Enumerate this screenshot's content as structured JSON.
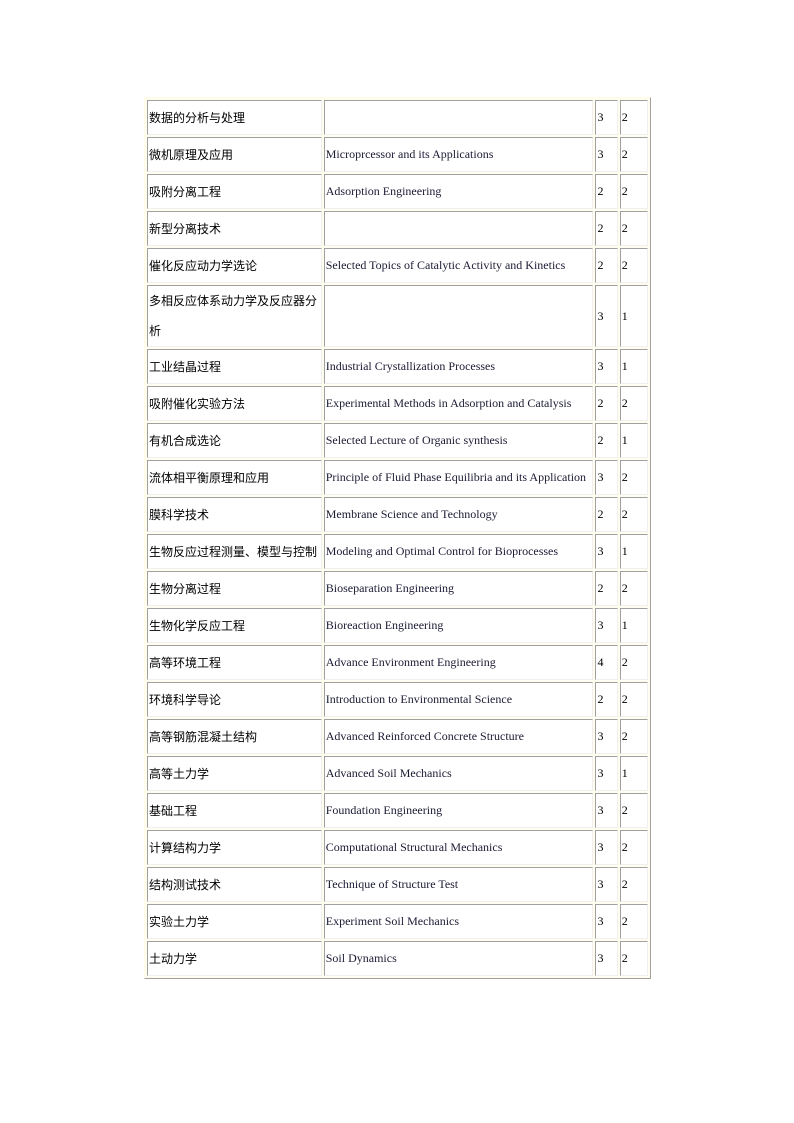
{
  "courses": [
    {
      "zh": "数据的分析与处理",
      "en": "",
      "a": "3",
      "b": "2"
    },
    {
      "zh": "微机原理及应用",
      "en": "Microprcessor and its Applications",
      "a": "3",
      "b": "2"
    },
    {
      "zh": "吸附分离工程",
      "en": "Adsorption Engineering",
      "a": "2",
      "b": "2"
    },
    {
      "zh": "新型分离技术",
      "en": "",
      "a": "2",
      "b": "2"
    },
    {
      "zh": "催化反应动力学选论",
      "en": "Selected  Topics of Catalytic  Activity and Kinetics",
      "a": "2",
      "b": "2"
    },
    {
      "zh": "多相反应体系动力学及反应器分析",
      "en": "",
      "a": "3",
      "b": "1"
    },
    {
      "zh": "工业结晶过程",
      "en": "Industrial Crystallization  Processes",
      "a": "3",
      "b": "1"
    },
    {
      "zh": "吸附催化实验方法",
      "en": "Experimental  Methods in Adsorption and Catalysis",
      "a": "2",
      "b": "2"
    },
    {
      "zh": "有机合成选论",
      "en": "Selected Lecture of Organic synthesis",
      "a": "2",
      "b": "1"
    },
    {
      "zh": "流体相平衡原理和应用",
      "en": "Principle of Fluid Phase Equilibria  and its Application",
      "a": "3",
      "b": "2"
    },
    {
      "zh": "膜科学技术",
      "en": "Membrane  Science  and  Technology",
      "a": "2",
      "b": "2"
    },
    {
      "zh": "生物反应过程测量、模型与控制",
      "en": "Modeling  and Optimal  Control  for Bioprocesses",
      "a": "3",
      "b": "1"
    },
    {
      "zh": "生物分离过程",
      "en": "Bioseparation  Engineering",
      "a": "2",
      "b": "2"
    },
    {
      "zh": "生物化学反应工程",
      "en": "Bioreaction  Engineering",
      "a": "3",
      "b": "1"
    },
    {
      "zh": "高等环境工程",
      "en": "Advance Environment Engineering",
      "a": "4",
      "b": "2"
    },
    {
      "zh": "环境科学导论",
      "en": "Introduction to Environmental  Science",
      "a": "2",
      "b": "2"
    },
    {
      "zh": "高等钢筋混凝土结构",
      "en": "Advanced Reinforced Concrete Structure",
      "a": "3",
      "b": "2"
    },
    {
      "zh": "高等土力学",
      "en": "Advanced Soil Mechanics",
      "a": "3",
      "b": "1"
    },
    {
      "zh": "基础工程",
      "en": "Foundation Engineering",
      "a": "3",
      "b": "2"
    },
    {
      "zh": "计算结构力学",
      "en": "Computational  Structural  Mechanics",
      "a": "3",
      "b": "2"
    },
    {
      "zh": "结构测试技术",
      "en": "Technique  of Structure  Test",
      "a": "3",
      "b": "2"
    },
    {
      "zh": "实验土力学",
      "en": "Experiment  Soil Mechanics",
      "a": "3",
      "b": "2"
    },
    {
      "zh": "土动力学",
      "en": "Soil Dynamics",
      "a": "3",
      "b": "2"
    }
  ]
}
